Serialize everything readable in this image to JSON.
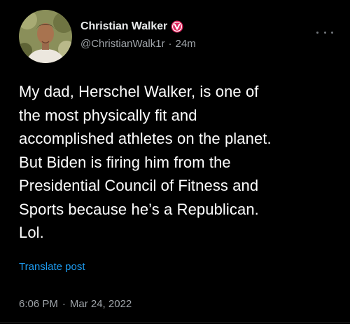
{
  "author": {
    "display_name": "Christian Walker",
    "handle": "@ChristianWalk1r",
    "separator": "·",
    "relative_time": "24m",
    "badge_icon": "verified-v-icon",
    "badge_color": "#e0245e"
  },
  "tweet": {
    "text_lines": [
      "My dad, Herschel Walker, is one of",
      "the most physically fit and",
      "accomplished athletes on the planet.",
      "But Biden is firing him from the",
      "Presidential Council of Fitness and",
      "Sports because he’s a Republican.",
      "Lol."
    ],
    "translate_label": "Translate post",
    "time": "6:06 PM",
    "separator": "·",
    "date": "Mar 24, 2022"
  },
  "colors": {
    "background": "#000000",
    "text": "#ffffff",
    "secondary": "#9ea3a8",
    "link": "#1d9bf0"
  },
  "icons": {
    "more": "more-horizontal-icon"
  }
}
